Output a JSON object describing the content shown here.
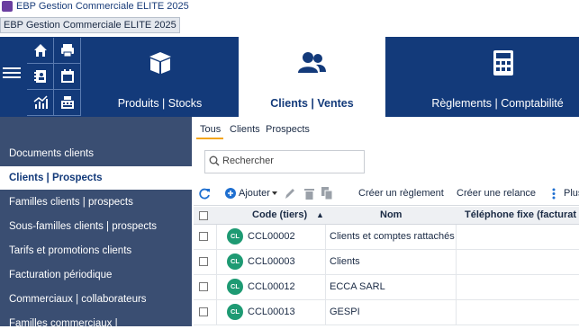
{
  "window": {
    "title": "EBP Gestion Commerciale ELITE 2025",
    "tab_label": "EBP Gestion Commerciale ELITE 2025"
  },
  "ribbon": {
    "tabs": [
      {
        "label": "Produits | Stocks",
        "icon": "box-icon"
      },
      {
        "label": "Clients | Ventes",
        "icon": "users-icon",
        "active": true
      },
      {
        "label": "Règlements | Comptabilité",
        "icon": "calculator-icon"
      }
    ],
    "quick_access_icons": [
      "home-icon",
      "print-icon",
      "address-book-icon",
      "calendar-icon",
      "chart-icon",
      "cash-register-icon"
    ]
  },
  "sidebar": {
    "items": [
      {
        "label": "Documents clients"
      },
      {
        "label": "Clients | Prospects",
        "active": true
      },
      {
        "label": "Familles clients | prospects"
      },
      {
        "label": "Sous-familles clients | prospects"
      },
      {
        "label": "Tarifs et promotions clients"
      },
      {
        "label": "Facturation périodique"
      },
      {
        "label": "Commerciaux | collaborateurs"
      },
      {
        "label": "Familles commerciaux |"
      }
    ]
  },
  "filters": {
    "tabs": [
      "Tous",
      "Clients",
      "Prospects"
    ],
    "active": "Tous"
  },
  "search": {
    "placeholder": "Rechercher"
  },
  "toolbar": {
    "add_label": "Ajouter",
    "create_payment": "Créer un règlement",
    "create_reminder": "Créer une relance",
    "more": "Plus"
  },
  "table": {
    "columns": [
      "Code (tiers)",
      "Nom",
      "Téléphone fixe (facturat"
    ],
    "sort_indicator": "▲",
    "rows": [
      {
        "badge": "CL",
        "code": "CCL00002",
        "name": "Clients et comptes rattachés",
        "phone": ""
      },
      {
        "badge": "CL",
        "code": "CCL00003",
        "name": "Clients",
        "phone": ""
      },
      {
        "badge": "CL",
        "code": "CCL00012",
        "name": "ECCA SARL",
        "phone": ""
      },
      {
        "badge": "CL",
        "code": "CCL00013",
        "name": "GESPI",
        "phone": ""
      }
    ]
  },
  "colors": {
    "ribbon": "#133a7a",
    "sidebar": "#3a4e72",
    "accent": "#f3a51c",
    "badge": "#1e9a73"
  }
}
